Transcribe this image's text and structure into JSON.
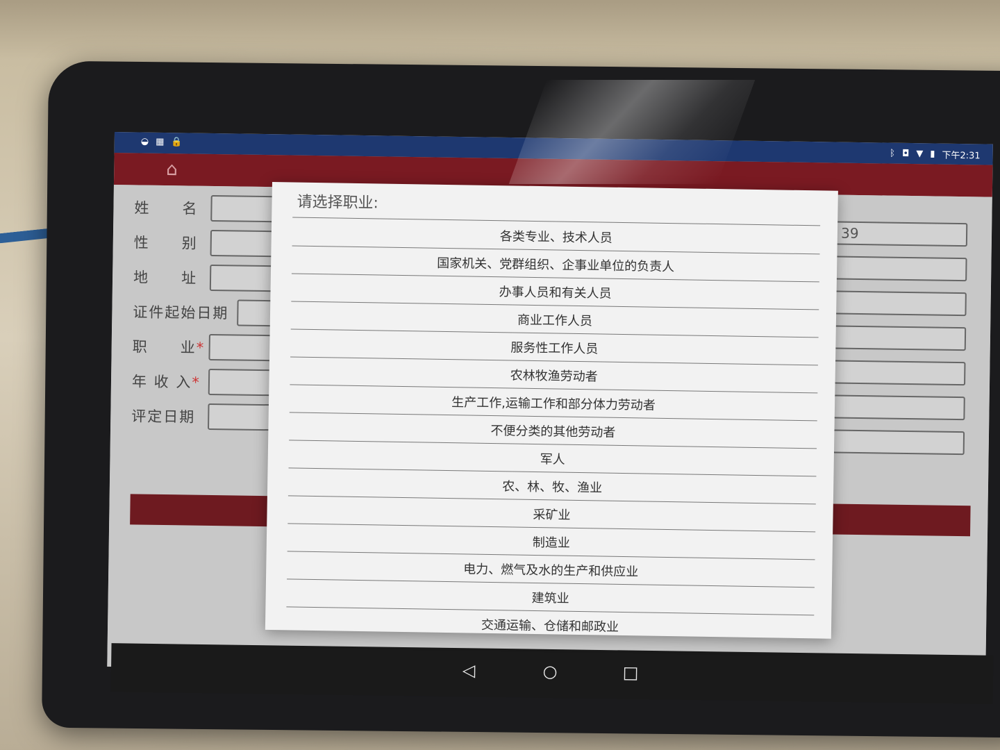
{
  "status_bar": {
    "time": "下午2:31"
  },
  "form": {
    "fields": [
      {
        "label": "姓　　名",
        "required": false
      },
      {
        "label": "性　　别",
        "required": false
      },
      {
        "label": "地　　址",
        "required": false
      },
      {
        "label": "证件起始日期",
        "required": false
      },
      {
        "label": "职　　业",
        "required": true
      },
      {
        "label": "年 收 入",
        "required": true
      },
      {
        "label": "评定日期",
        "required": false
      }
    ],
    "right_field_partial_value": "39",
    "required_marker": "*"
  },
  "dialog": {
    "title": "请选择职业:",
    "options": [
      "各类专业、技术人员",
      "国家机关、党群组织、企事业单位的负责人",
      "办事人员和有关人员",
      "商业工作人员",
      "服务性工作人员",
      "农林牧渔劳动者",
      "生产工作,运输工作和部分体力劳动者",
      "不便分类的其他劳动者",
      "军人",
      "农、林、牧、渔业",
      "采矿业",
      "制造业",
      "电力、燃气及水的生产和供应业",
      "建筑业",
      "交通运输、仓储和邮政业"
    ]
  },
  "colors": {
    "status_bar": "#1e3870",
    "app_bar": "#7a1a22",
    "submit_bar": "#6e1a20",
    "dialog_bg": "#f2f2f2"
  },
  "icons": {
    "home": "home-icon",
    "back": "back-triangle-icon",
    "home_nav": "circle-home-icon",
    "recents": "square-recents-icon"
  }
}
